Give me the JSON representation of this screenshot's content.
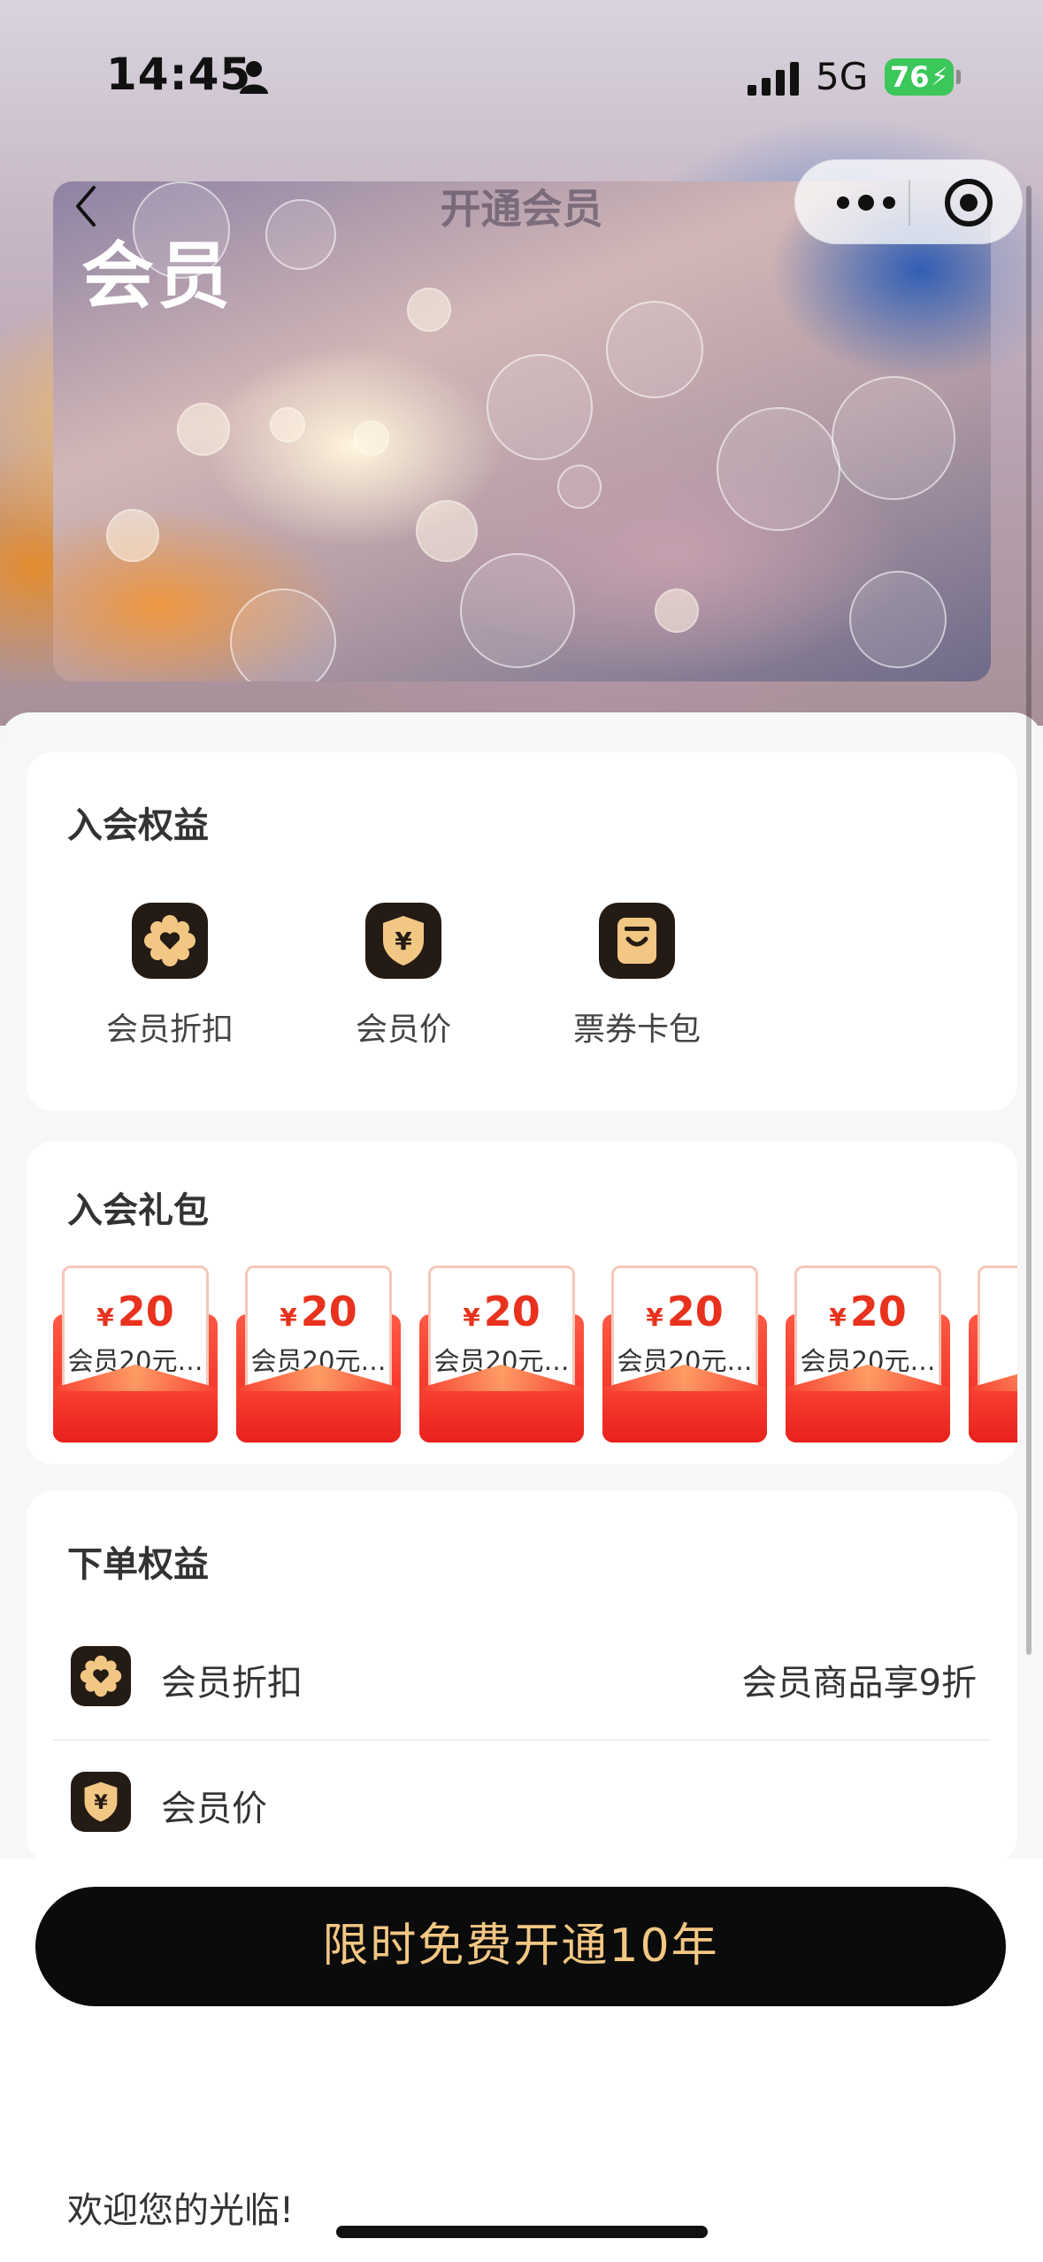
{
  "status_bar": {
    "time": "14:45",
    "network": "5G",
    "battery": "76"
  },
  "nav": {
    "title": "开通会员"
  },
  "banner": {
    "title": "会员"
  },
  "join_benefits": {
    "heading": "入会权益",
    "items": [
      {
        "label": "会员折扣",
        "icon": "flower-heart-icon"
      },
      {
        "label": "会员价",
        "icon": "yen-shield-icon"
      },
      {
        "label": "票券卡包",
        "icon": "wallet-icon"
      }
    ]
  },
  "join_gifts": {
    "heading": "入会礼包",
    "currency": "¥",
    "coupons": [
      {
        "amount": "20",
        "desc": "会员20元…"
      },
      {
        "amount": "20",
        "desc": "会员20元…"
      },
      {
        "amount": "20",
        "desc": "会员20元…"
      },
      {
        "amount": "20",
        "desc": "会员20元…"
      },
      {
        "amount": "20",
        "desc": "会员20元…"
      }
    ]
  },
  "order_benefits": {
    "heading": "下单权益",
    "rows": [
      {
        "name": "会员折扣",
        "value": "会员商品享9折",
        "icon": "flower-heart-icon"
      },
      {
        "name": "会员价",
        "value": "",
        "icon": "yen-shield-icon"
      }
    ]
  },
  "cta": {
    "label": "限时免费开通10年"
  },
  "footer": {
    "welcome": "欢迎您的光临!"
  },
  "colors": {
    "accent_gold": "#f3c783",
    "coupon_red": "#e8321e",
    "icon_dark": "#241b14"
  }
}
